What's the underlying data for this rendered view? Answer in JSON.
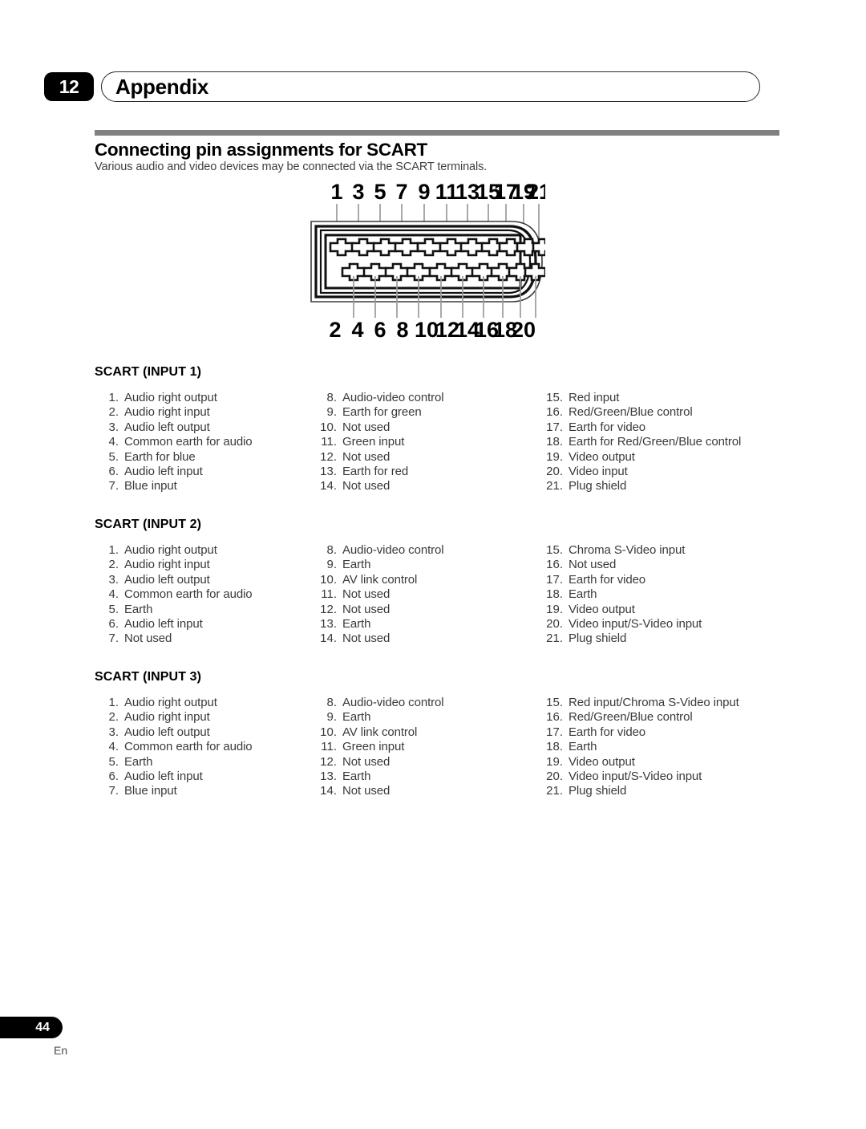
{
  "header": {
    "chapter_number": "12",
    "chapter_title": "Appendix"
  },
  "section": {
    "title": "Connecting pin assignments for SCART",
    "subtitle": "Various audio and video devices may be connected via the SCART terminals."
  },
  "diagram": {
    "name": "scart-connector-pinout",
    "top_pin_labels": [
      "1",
      "3",
      "5",
      "7",
      "9",
      "11",
      "13",
      "15",
      "17",
      "19",
      "21"
    ],
    "bottom_pin_labels": [
      "2",
      "4",
      "6",
      "8",
      "10",
      "12",
      "14",
      "16",
      "18",
      "20"
    ],
    "total_pins": 21
  },
  "tables": [
    {
      "heading": "SCART (INPUT 1)",
      "columns": [
        [
          {
            "num": "1.",
            "desc": "Audio right output"
          },
          {
            "num": "2.",
            "desc": "Audio right input"
          },
          {
            "num": "3.",
            "desc": "Audio left output"
          },
          {
            "num": "4.",
            "desc": "Common earth for audio"
          },
          {
            "num": "5.",
            "desc": "Earth for blue"
          },
          {
            "num": "6.",
            "desc": "Audio left input"
          },
          {
            "num": "7.",
            "desc": "Blue input"
          }
        ],
        [
          {
            "num": "8.",
            "desc": "Audio-video control"
          },
          {
            "num": "9.",
            "desc": "Earth for green"
          },
          {
            "num": "10.",
            "desc": "Not used"
          },
          {
            "num": "11.",
            "desc": "Green input"
          },
          {
            "num": "12.",
            "desc": "Not used"
          },
          {
            "num": "13.",
            "desc": "Earth for red"
          },
          {
            "num": "14.",
            "desc": "Not used"
          }
        ],
        [
          {
            "num": "15.",
            "desc": "Red input"
          },
          {
            "num": "16.",
            "desc": "Red/Green/Blue control"
          },
          {
            "num": "17.",
            "desc": "Earth for video"
          },
          {
            "num": "18.",
            "desc": "Earth for Red/Green/Blue control"
          },
          {
            "num": "19.",
            "desc": "Video output"
          },
          {
            "num": "20.",
            "desc": "Video input"
          },
          {
            "num": "21.",
            "desc": "Plug shield"
          }
        ]
      ]
    },
    {
      "heading": "SCART (INPUT 2)",
      "columns": [
        [
          {
            "num": "1.",
            "desc": "Audio right output"
          },
          {
            "num": "2.",
            "desc": "Audio right input"
          },
          {
            "num": "3.",
            "desc": "Audio left output"
          },
          {
            "num": "4.",
            "desc": "Common earth for audio"
          },
          {
            "num": "5.",
            "desc": "Earth"
          },
          {
            "num": "6.",
            "desc": "Audio left input"
          },
          {
            "num": "7.",
            "desc": "Not used"
          }
        ],
        [
          {
            "num": "8.",
            "desc": "Audio-video control"
          },
          {
            "num": "9.",
            "desc": "Earth"
          },
          {
            "num": "10.",
            "desc": "AV link control"
          },
          {
            "num": "11.",
            "desc": "Not used"
          },
          {
            "num": "12.",
            "desc": "Not used"
          },
          {
            "num": "13.",
            "desc": "Earth"
          },
          {
            "num": "14.",
            "desc": "Not used"
          }
        ],
        [
          {
            "num": "15.",
            "desc": "Chroma S-Video input"
          },
          {
            "num": "16.",
            "desc": "Not used"
          },
          {
            "num": "17.",
            "desc": "Earth for video"
          },
          {
            "num": "18.",
            "desc": "Earth"
          },
          {
            "num": "19.",
            "desc": "Video output"
          },
          {
            "num": "20.",
            "desc": "Video input/S-Video input"
          },
          {
            "num": "21.",
            "desc": "Plug shield"
          }
        ]
      ]
    },
    {
      "heading": "SCART (INPUT 3)",
      "columns": [
        [
          {
            "num": "1.",
            "desc": "Audio right output"
          },
          {
            "num": "2.",
            "desc": "Audio right input"
          },
          {
            "num": "3.",
            "desc": "Audio left output"
          },
          {
            "num": "4.",
            "desc": "Common earth for audio"
          },
          {
            "num": "5.",
            "desc": "Earth"
          },
          {
            "num": "6.",
            "desc": "Audio left input"
          },
          {
            "num": "7.",
            "desc": "Blue input"
          }
        ],
        [
          {
            "num": "8.",
            "desc": "Audio-video control"
          },
          {
            "num": "9.",
            "desc": "Earth"
          },
          {
            "num": "10.",
            "desc": "AV link control"
          },
          {
            "num": "11.",
            "desc": "Green input"
          },
          {
            "num": "12.",
            "desc": "Not used"
          },
          {
            "num": "13.",
            "desc": "Earth"
          },
          {
            "num": "14.",
            "desc": "Not used"
          }
        ],
        [
          {
            "num": "15.",
            "desc": "Red input/Chroma S-Video input"
          },
          {
            "num": "16.",
            "desc": "Red/Green/Blue control"
          },
          {
            "num": "17.",
            "desc": "Earth for video"
          },
          {
            "num": "18.",
            "desc": "Earth"
          },
          {
            "num": "19.",
            "desc": "Video output"
          },
          {
            "num": "20.",
            "desc": "Video input/S-Video input"
          },
          {
            "num": "21.",
            "desc": "Plug shield"
          }
        ]
      ]
    }
  ],
  "footer": {
    "page_number": "44",
    "language": "En"
  },
  "colors": {
    "rule_gray": "#808080",
    "body_text": "#3a3a3a",
    "heading_black": "#000000"
  }
}
